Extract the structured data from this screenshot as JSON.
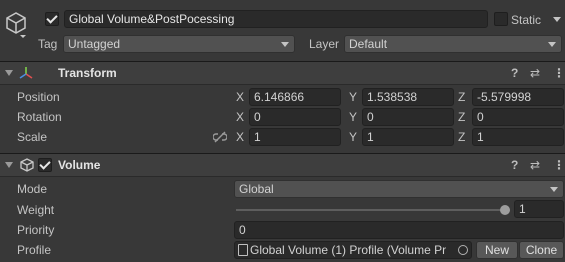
{
  "gameobject": {
    "name": "Global Volume&PostPocessing",
    "active": true,
    "static_label": "Static",
    "static_checked": false,
    "tag_label": "Tag",
    "tag_value": "Untagged",
    "layer_label": "Layer",
    "layer_value": "Default"
  },
  "transform": {
    "title": "Transform",
    "position_label": "Position",
    "rotation_label": "Rotation",
    "scale_label": "Scale",
    "axis_x": "X",
    "axis_y": "Y",
    "axis_z": "Z",
    "position": {
      "x": "6.146866",
      "y": "1.538538",
      "z": "-5.579998"
    },
    "rotation": {
      "x": "0",
      "y": "0",
      "z": "0"
    },
    "scale": {
      "x": "1",
      "y": "1",
      "z": "1"
    }
  },
  "volume": {
    "title": "Volume",
    "enabled": true,
    "mode_label": "Mode",
    "mode_value": "Global",
    "weight_label": "Weight",
    "weight_value": "1",
    "weight_fraction": 1.0,
    "priority_label": "Priority",
    "priority_value": "0",
    "profile_label": "Profile",
    "profile_value": "Global Volume (1) Profile (Volume Pr",
    "new_label": "New",
    "clone_label": "Clone"
  },
  "colors": {
    "background": "#383838",
    "header": "#3e3e3e",
    "field": "#2a2a2a"
  }
}
